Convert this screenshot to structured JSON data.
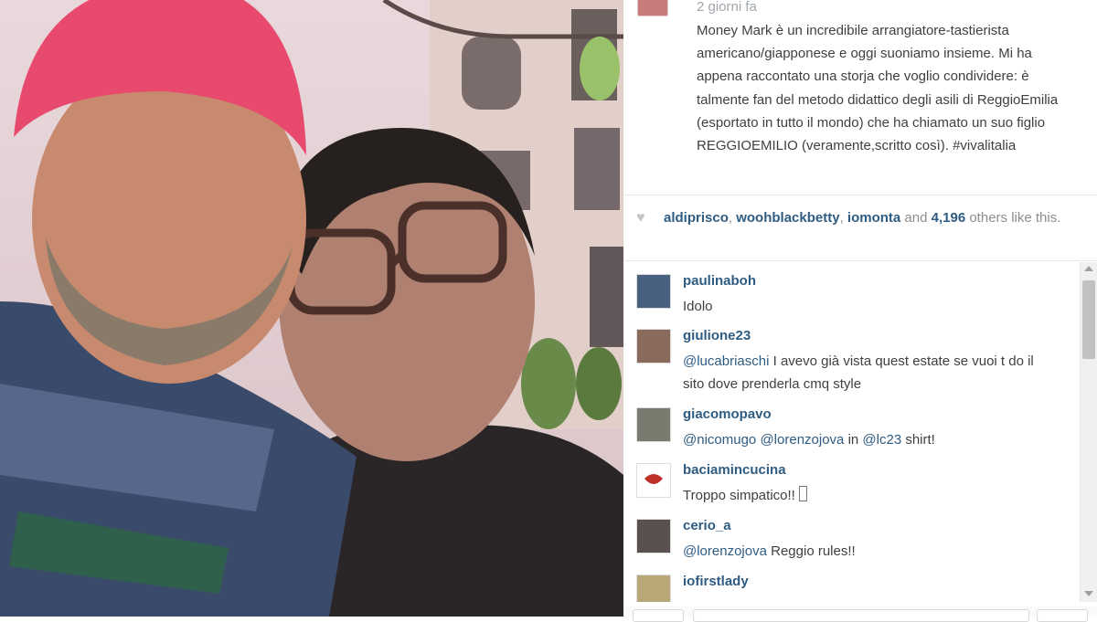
{
  "post": {
    "time": "2 giorni fa",
    "caption": "Money Mark è un incredibile arrangiatore-tastierista americano/giapponese e oggi suoniamo insieme. Mi ha appena raccontato una storja che voglio condividere: è talmente fan del metodo didattico degli asili di ReggioEmilia (esportato in tutto il mondo) che ha chiamato un suo figlio REGGIOEMILIO (veramente,scritto così). #vivalitalia",
    "photo_alt": "Selfie of two men"
  },
  "likes": {
    "icon": "heart-icon",
    "users": [
      "aldiprisco",
      "woohblackbetty",
      "iomonta"
    ],
    "and": "and",
    "count": "4,196",
    "suffix": "others like this."
  },
  "comments": [
    {
      "user": "paulinaboh",
      "text": "Idolo",
      "avatar_color": "#4a6080"
    },
    {
      "user": "giulione23",
      "mention": "@lucabriaschi",
      "text": " I avevo già vista quest estate se vuoi t do il sito dove prenderla cmq style",
      "avatar_color": "#8a6a5a"
    },
    {
      "user": "giacomopavo",
      "mention": "@nicomugo",
      "mention2": "@lorenzojova",
      "mid": " in ",
      "mention3": "@lc23",
      "text": " shirt!",
      "avatar_color": "#7a7a6e"
    },
    {
      "user": "baciamincucina",
      "text": "Troppo simpatico!! ",
      "avatar_color": "#ffffff"
    },
    {
      "user": "cerio_a",
      "mention": "@lorenzojova",
      "text": " Reggio rules!!",
      "avatar_color": "#5a5050"
    },
    {
      "user": "iofirstlady",
      "text": "",
      "avatar_color": "#b8a878"
    }
  ]
}
